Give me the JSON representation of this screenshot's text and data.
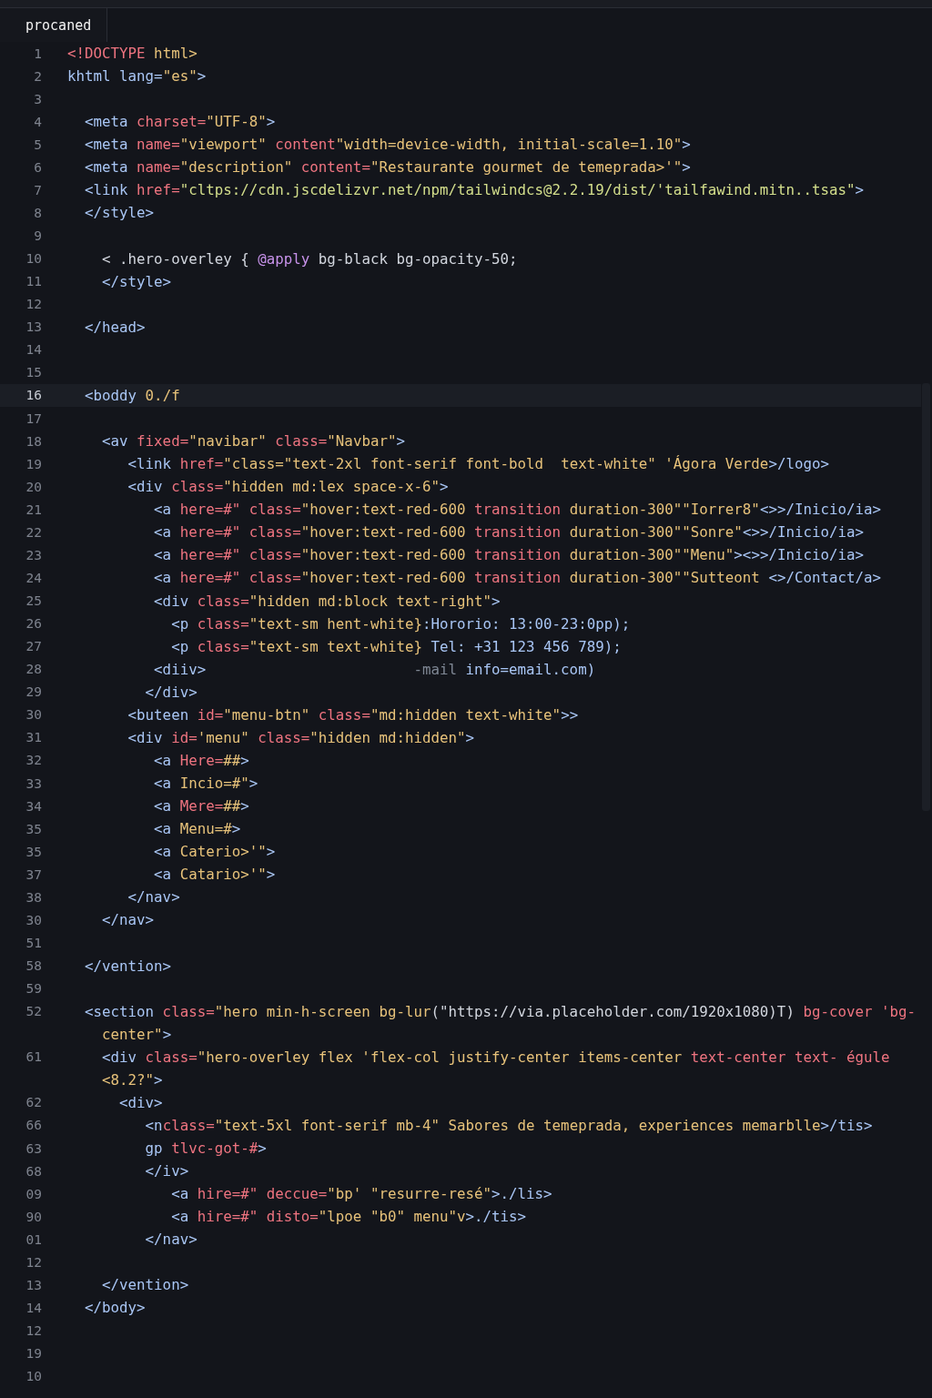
{
  "tab": {
    "label": "procaned",
    "selected": true
  },
  "lines": [
    {
      "number": "1",
      "current": false,
      "rows": [
        [
          {
            "text": "<!DOCTYPE",
            "kind": "attr"
          },
          {
            "text": " html>",
            "kind": "string"
          }
        ]
      ]
    },
    {
      "number": "2",
      "current": false,
      "rows": [
        [
          {
            "text": "khtml",
            "kind": "tag"
          },
          {
            "text": " lang=",
            "kind": "tag"
          },
          {
            "text": "\"es\"",
            "kind": "string"
          },
          {
            "text": ">",
            "kind": "tag"
          }
        ]
      ]
    },
    {
      "number": "3",
      "current": false
    },
    {
      "number": "4",
      "current": false,
      "rows": [
        [
          {
            "text": "  <meta",
            "kind": "tag"
          },
          {
            "text": " charset=",
            "kind": "attr"
          },
          {
            "text": "\"UTF-8\"",
            "kind": "string"
          },
          {
            "text": ">",
            "kind": "tag"
          }
        ]
      ]
    },
    {
      "number": "5",
      "current": false,
      "rows": [
        [
          {
            "text": "  <meta",
            "kind": "tag"
          },
          {
            "text": " name=",
            "kind": "attr"
          },
          {
            "text": "\"viewport\"",
            "kind": "string"
          },
          {
            "text": " content",
            "kind": "attr"
          },
          {
            "text": "\"width=device-width, initial-scale=1.10\"",
            "kind": "string"
          },
          {
            "text": ">",
            "kind": "tag"
          }
        ]
      ]
    },
    {
      "number": "6",
      "current": false,
      "rows": [
        [
          {
            "text": "  <meta",
            "kind": "tag"
          },
          {
            "text": " name=",
            "kind": "attr"
          },
          {
            "text": "\"description\"",
            "kind": "string"
          },
          {
            "text": " content=",
            "kind": "attr"
          },
          {
            "text": "\"Restaurante gourmet de temeprada>'\"",
            "kind": "string"
          },
          {
            "text": ">",
            "kind": "tag"
          }
        ]
      ]
    },
    {
      "number": "7",
      "current": false,
      "rows": [
        [
          {
            "text": "  <link",
            "kind": "tag"
          },
          {
            "text": " href=",
            "kind": "attr"
          },
          {
            "text": "\"cltps://cdn.jscdelizvr.net/npm/tailwindcs@2.2.19/dist/'tailfawind.mitn..tsas\"",
            "kind": "green"
          },
          {
            "text": ">",
            "kind": "tag"
          }
        ]
      ]
    },
    {
      "number": "8",
      "current": false,
      "rows": [
        [
          {
            "text": "  </style>",
            "kind": "tag"
          }
        ]
      ]
    },
    {
      "number": "9",
      "current": false
    },
    {
      "number": "10",
      "current": false,
      "rows": [
        [
          {
            "text": "    < .hero-overley { ",
            "kind": "plain"
          },
          {
            "text": "@apply",
            "kind": "keyword"
          },
          {
            "text": " bg-black bg-opacity-50;",
            "kind": "plain"
          }
        ]
      ]
    },
    {
      "number": "11",
      "current": false,
      "rows": [
        [
          {
            "text": "    </style>",
            "kind": "tag"
          }
        ]
      ]
    },
    {
      "number": "12",
      "current": false
    },
    {
      "number": "13",
      "current": false,
      "rows": [
        [
          {
            "text": "  </head>",
            "kind": "tag"
          }
        ]
      ]
    },
    {
      "number": "14",
      "current": false
    },
    {
      "number": "15",
      "current": false
    },
    {
      "number": "16",
      "current": true,
      "rows": [
        [
          {
            "text": "  <boddy",
            "kind": "tag"
          },
          {
            "text": " 0./f",
            "kind": "string"
          }
        ]
      ]
    },
    {
      "number": "17",
      "current": false
    },
    {
      "number": "18",
      "current": false,
      "rows": [
        [
          {
            "text": "    <av",
            "kind": "tag"
          },
          {
            "text": " fixed=",
            "kind": "attr"
          },
          {
            "text": "\"navibar\"",
            "kind": "string"
          },
          {
            "text": " class=",
            "kind": "attr"
          },
          {
            "text": "\"Navbar\"",
            "kind": "string"
          },
          {
            "text": ">",
            "kind": "tag"
          }
        ]
      ]
    },
    {
      "number": "19",
      "current": false,
      "rows": [
        [
          {
            "text": "       <link",
            "kind": "tag"
          },
          {
            "text": " href=",
            "kind": "attr"
          },
          {
            "text": "\"class=\"text-2xl font-serif font-bold  text-white\" 'Ágora Verde",
            "kind": "string"
          },
          {
            "text": ">/logo>",
            "kind": "tag"
          }
        ]
      ]
    },
    {
      "number": "20",
      "current": false,
      "rows": [
        [
          {
            "text": "       <div",
            "kind": "tag"
          },
          {
            "text": " class=",
            "kind": "attr"
          },
          {
            "text": "\"hidden md:lex space-x-6\"",
            "kind": "string"
          },
          {
            "text": ">",
            "kind": "tag"
          }
        ]
      ]
    },
    {
      "number": "21",
      "current": false,
      "rows": [
        [
          {
            "text": "          <a",
            "kind": "tag"
          },
          {
            "text": " here=#\" class=",
            "kind": "attr"
          },
          {
            "text": "\"hover:text-red-600",
            "kind": "string"
          },
          {
            "text": " transition",
            "kind": "attr"
          },
          {
            "text": " duration-300\"\"Iorrer8\"",
            "kind": "string"
          },
          {
            "text": "<>>/Inicio/ia>",
            "kind": "tag"
          }
        ]
      ]
    },
    {
      "number": "22",
      "current": false,
      "rows": [
        [
          {
            "text": "          <a",
            "kind": "tag"
          },
          {
            "text": " here=#\" class=",
            "kind": "attr"
          },
          {
            "text": "\"hover:text-red-600",
            "kind": "string"
          },
          {
            "text": " transition",
            "kind": "attr"
          },
          {
            "text": " duration-300\"\"Sonre\"",
            "kind": "string"
          },
          {
            "text": "<>>/Inicio/ia>",
            "kind": "tag"
          }
        ]
      ]
    },
    {
      "number": "23",
      "current": false,
      "rows": [
        [
          {
            "text": "          <a",
            "kind": "tag"
          },
          {
            "text": " here=#\" class=",
            "kind": "attr"
          },
          {
            "text": "\"hover:text-red-600",
            "kind": "string"
          },
          {
            "text": " transition",
            "kind": "attr"
          },
          {
            "text": " duration-300\"\"Menu\"",
            "kind": "string"
          },
          {
            "text": "><>>/Inicio/ia>",
            "kind": "tag"
          }
        ]
      ]
    },
    {
      "number": "24",
      "current": false,
      "rows": [
        [
          {
            "text": "          <a",
            "kind": "tag"
          },
          {
            "text": " here=#\" class=",
            "kind": "attr"
          },
          {
            "text": "\"hover:text-red-600",
            "kind": "string"
          },
          {
            "text": " transition",
            "kind": "attr"
          },
          {
            "text": " duration-300\"\"Sutteont",
            "kind": "string"
          },
          {
            "text": " <>/Contact/a>",
            "kind": "tag"
          }
        ]
      ]
    },
    {
      "number": "25",
      "current": false,
      "rows": [
        [
          {
            "text": "          <div",
            "kind": "tag"
          },
          {
            "text": " class=",
            "kind": "attr"
          },
          {
            "text": "\"hidden md:block text-right\"",
            "kind": "string"
          },
          {
            "text": ">",
            "kind": "tag"
          }
        ]
      ]
    },
    {
      "number": "26",
      "current": false,
      "rows": [
        [
          {
            "text": "            <p",
            "kind": "tag"
          },
          {
            "text": " class=",
            "kind": "attr"
          },
          {
            "text": "\"text-sm hent-white}",
            "kind": "string"
          },
          {
            "text": ":Hororio: 13:00-23:0pp);",
            "kind": "tag"
          }
        ]
      ]
    },
    {
      "number": "27",
      "current": false,
      "rows": [
        [
          {
            "text": "            <p",
            "kind": "tag"
          },
          {
            "text": " class=",
            "kind": "attr"
          },
          {
            "text": "\"text-sm text-white}",
            "kind": "string"
          },
          {
            "text": " Tel: +31 123 456 789);",
            "kind": "tag"
          }
        ]
      ]
    },
    {
      "number": "28",
      "current": false,
      "rows": [
        [
          {
            "text": "          <diiv>",
            "kind": "tag"
          },
          {
            "text": "                        -mail",
            "kind": "dim"
          },
          {
            "text": " info=email.com)",
            "kind": "tag"
          }
        ]
      ]
    },
    {
      "number": "29",
      "current": false,
      "rows": [
        [
          {
            "text": "         </div>",
            "kind": "tag"
          }
        ]
      ]
    },
    {
      "number": "30",
      "current": false,
      "rows": [
        [
          {
            "text": "       <buteen",
            "kind": "tag"
          },
          {
            "text": " id=",
            "kind": "attr"
          },
          {
            "text": "\"menu-btn\"",
            "kind": "string"
          },
          {
            "text": " class=",
            "kind": "attr"
          },
          {
            "text": "\"md:hidden text-white\"",
            "kind": "string"
          },
          {
            "text": ">>",
            "kind": "tag"
          }
        ]
      ]
    },
    {
      "number": "31",
      "current": false,
      "rows": [
        [
          {
            "text": "       <div",
            "kind": "tag"
          },
          {
            "text": " id=",
            "kind": "attr"
          },
          {
            "text": "'menu\"",
            "kind": "string"
          },
          {
            "text": " class=",
            "kind": "attr"
          },
          {
            "text": "\"hidden md:hidden\"",
            "kind": "string"
          },
          {
            "text": ">",
            "kind": "tag"
          }
        ]
      ]
    },
    {
      "number": "32",
      "current": false,
      "rows": [
        [
          {
            "text": "          <a",
            "kind": "tag"
          },
          {
            "text": " Here=",
            "kind": "attr"
          },
          {
            "text": "##",
            "kind": "string"
          },
          {
            "text": ">",
            "kind": "tag"
          }
        ]
      ]
    },
    {
      "number": "33",
      "current": false,
      "rows": [
        [
          {
            "text": "          <a",
            "kind": "tag"
          },
          {
            "text": " Incio",
            "kind": "string"
          },
          {
            "text": "=#\"",
            "kind": "string"
          },
          {
            "text": ">",
            "kind": "tag"
          }
        ]
      ]
    },
    {
      "number": "34",
      "current": false,
      "rows": [
        [
          {
            "text": "          <a",
            "kind": "tag"
          },
          {
            "text": " Mere=",
            "kind": "attr"
          },
          {
            "text": "##",
            "kind": "string"
          },
          {
            "text": ">",
            "kind": "tag"
          }
        ]
      ]
    },
    {
      "number": "35",
      "current": false,
      "rows": [
        [
          {
            "text": "          <a",
            "kind": "tag"
          },
          {
            "text": " Menu",
            "kind": "string"
          },
          {
            "text": "=#",
            "kind": "string"
          },
          {
            "text": ">",
            "kind": "tag"
          }
        ]
      ]
    },
    {
      "number": "35",
      "current": false,
      "rows": [
        [
          {
            "text": "          <a",
            "kind": "tag"
          },
          {
            "text": " Caterio>'\"",
            "kind": "string"
          },
          {
            "text": ">",
            "kind": "tag"
          }
        ]
      ]
    },
    {
      "number": "37",
      "current": false,
      "rows": [
        [
          {
            "text": "          <a",
            "kind": "tag"
          },
          {
            "text": " Catario>'\"",
            "kind": "string"
          },
          {
            "text": ">",
            "kind": "tag"
          }
        ]
      ]
    },
    {
      "number": "38",
      "current": false,
      "rows": [
        [
          {
            "text": "       </nav>",
            "kind": "tag"
          }
        ]
      ]
    },
    {
      "number": "30",
      "current": false,
      "rows": [
        [
          {
            "text": "    </nav>",
            "kind": "tag"
          }
        ]
      ]
    },
    {
      "number": "51",
      "current": false
    },
    {
      "number": "58",
      "current": false,
      "rows": [
        [
          {
            "text": "  </vention>",
            "kind": "tag"
          }
        ]
      ]
    },
    {
      "number": "59",
      "current": false
    },
    {
      "number": "52",
      "current": false,
      "rows": [
        [
          {
            "text": "  <section",
            "kind": "tag"
          },
          {
            "text": " class=",
            "kind": "attr"
          },
          {
            "text": "\"hero min-h-screen bg-lur",
            "kind": "string"
          },
          {
            "text": "(\"https://via.placeholder.com/1920x1080)T)",
            "kind": "plain"
          },
          {
            "text": " bg-cover 'bg-",
            "kind": "attr"
          }
        ],
        [
          {
            "text": "    center\"",
            "kind": "string"
          },
          {
            "text": ">",
            "kind": "tag"
          }
        ]
      ]
    },
    {
      "number": "61",
      "current": false,
      "rows": [
        [
          {
            "text": "    <div",
            "kind": "tag"
          },
          {
            "text": " class=",
            "kind": "attr"
          },
          {
            "text": "\"hero-overley flex 'flex-col justify-center items-center",
            "kind": "string"
          },
          {
            "text": " text-center text- égule",
            "kind": "attr"
          }
        ],
        [
          {
            "text": "    <8.2?\"",
            "kind": "string"
          },
          {
            "text": ">",
            "kind": "tag"
          }
        ]
      ]
    },
    {
      "number": "62",
      "current": false,
      "rows": [
        [
          {
            "text": "      <div>",
            "kind": "tag"
          }
        ]
      ]
    },
    {
      "number": "66",
      "current": false,
      "rows": [
        [
          {
            "text": "         <n",
            "kind": "tag"
          },
          {
            "text": "class=",
            "kind": "attr"
          },
          {
            "text": "\"text-5xl font-serif mb-4\" Sabores de temeprada, experiences memarblle",
            "kind": "string"
          },
          {
            "text": ">/tis>",
            "kind": "tag"
          }
        ]
      ]
    },
    {
      "number": "63",
      "current": false,
      "rows": [
        [
          {
            "text": "         gp",
            "kind": "tag"
          },
          {
            "text": " tlvc-got-#",
            "kind": "attr"
          },
          {
            "text": ">",
            "kind": "tag"
          }
        ]
      ]
    },
    {
      "number": "68",
      "current": false,
      "rows": [
        [
          {
            "text": "         </iv>",
            "kind": "tag"
          }
        ]
      ]
    },
    {
      "number": "09",
      "current": false,
      "rows": [
        [
          {
            "text": "            <a",
            "kind": "tag"
          },
          {
            "text": " hire=#\" deccue=",
            "kind": "attr"
          },
          {
            "text": "\"bp' \"resurre-resé\"",
            "kind": "string"
          },
          {
            "text": ">./lis>",
            "kind": "tag"
          }
        ]
      ]
    },
    {
      "number": "90",
      "current": false,
      "rows": [
        [
          {
            "text": "            <a",
            "kind": "tag"
          },
          {
            "text": " hire=#\" disto=",
            "kind": "attr"
          },
          {
            "text": "\"lpoe \"b0\" menu\"v",
            "kind": "string"
          },
          {
            "text": ">./tis>",
            "kind": "tag"
          }
        ]
      ]
    },
    {
      "number": "01",
      "current": false,
      "rows": [
        [
          {
            "text": "         </nav>",
            "kind": "tag"
          }
        ]
      ]
    },
    {
      "number": "12",
      "current": false
    },
    {
      "number": "13",
      "current": false,
      "rows": [
        [
          {
            "text": "    </vention>",
            "kind": "tag"
          }
        ]
      ]
    },
    {
      "number": "14",
      "current": false,
      "rows": [
        [
          {
            "text": "  </body>",
            "kind": "tag"
          }
        ]
      ]
    },
    {
      "number": "12",
      "current": false
    },
    {
      "number": "19",
      "current": false
    },
    {
      "number": "10",
      "current": false
    }
  ]
}
